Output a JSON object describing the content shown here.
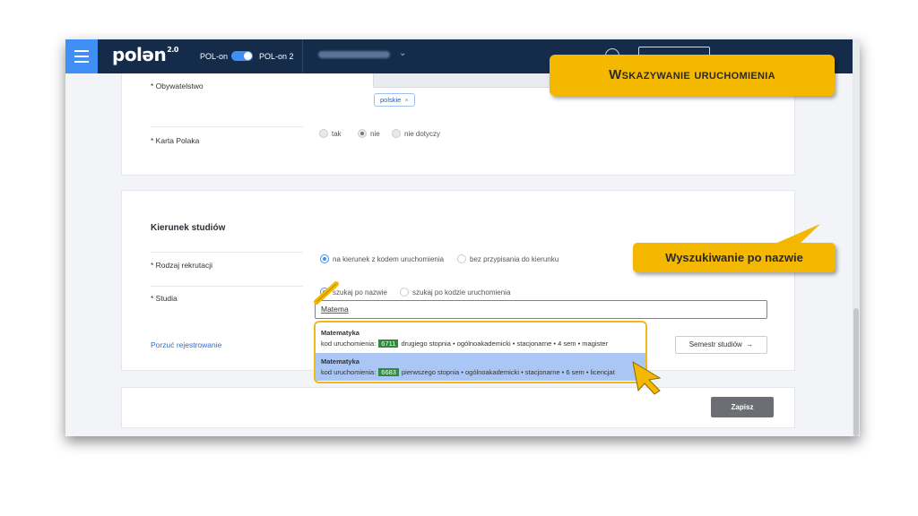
{
  "topbar": {
    "logo": "pol",
    "logo_middle": "ə",
    "logo_end": "n",
    "logo_version": "2.0",
    "toggle_left": "POL-on",
    "toggle_right": "POL-on 2"
  },
  "form": {
    "citizenship_label": "* Obywatelstwo",
    "citizenship_tag": "polskie",
    "tag_remove": "×",
    "karta_label": "* Karta Polaka",
    "karta_options": [
      "tak",
      "nie",
      "nie dotyczy"
    ],
    "section_title": "Kierunek studiów",
    "recruitment_label": "* Rodzaj rekrutacji",
    "recruitment_options": [
      "na kierunek z kodem uruchomienia",
      "bez przypisania do kierunku"
    ],
    "studies_label": "* Studia",
    "search_options": [
      "szukaj po nazwie",
      "szukaj po kodzie uruchomienia"
    ],
    "search_value": "Matema",
    "abandon_link": "Porzuć rejestrowanie",
    "semester_button": "Semestr studiów",
    "semester_arrow": "→",
    "save_button": "Zapisz"
  },
  "dropdown": {
    "items": [
      {
        "name": "Matematyka",
        "code_label": "kod uruchomienia:",
        "code": "6711",
        "details": "drugiego stopnia • ogólnoakademicki • stacjonarne • 4 sem • magister"
      },
      {
        "name": "Matematyka",
        "code_label": "kod uruchomienia:",
        "code": "6683",
        "details": "pierwszego stopnia • ogólnoakademicki • stacjonarne • 6 sem • licencjat"
      }
    ]
  },
  "callouts": {
    "title": "Wskazywanie uruchomienia",
    "hint": "Wyszukiwanie po nazwie"
  },
  "colors": {
    "topbar": "#142b4a",
    "accent": "#3f8ff5",
    "highlight": "#f5b800",
    "code_badge": "#2f8a3c"
  }
}
